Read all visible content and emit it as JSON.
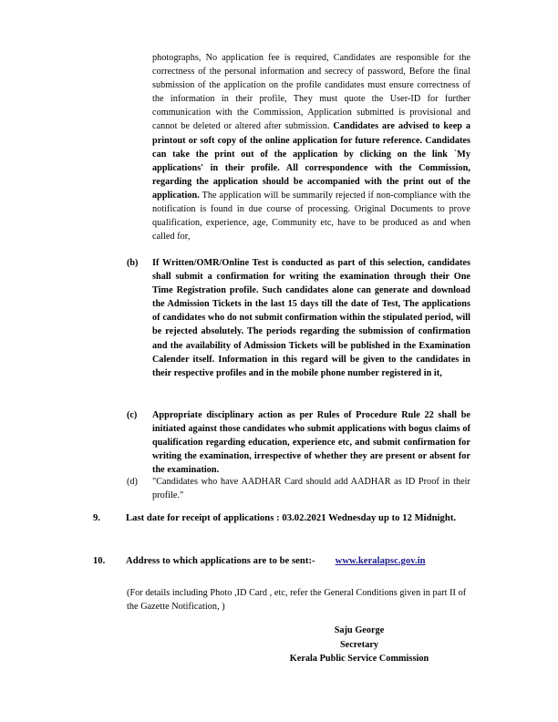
{
  "document": {
    "page_background": "#ffffff",
    "text_color": "#000000",
    "link_color": "#1a1a8c"
  },
  "continued_paragraph": {
    "segment_1": "photographs, No application fee is required, Candidates are responsible for the correctness of the personal information and secrecy of password, Before the final submission of the application on the profile candidates must ensure correctness of the information in their profile, They must quote the User-ID for further communication with the Commission, Application submitted is provisional and cannot be deleted or altered after submission. ",
    "segment_2_bold": "Candidates are advised to keep a printout or soft copy of the online application for future reference.  Candidates can take the print out of the application by clicking on the link `My applications' in their profile.    All correspondence with the Commission, regarding the application should be accompanied with the print out of the application.",
    "segment_3": " The application will be summarily rejected if non-compliance with the notification is found in due course of processing. Original Documents to prove qualification, experience, age, Community etc, have to be produced as and when called for,"
  },
  "list_items": [
    {
      "marker": "(b)",
      "bold": true,
      "text": "If Written/OMR/Online Test is conducted as part of this selection, candidates shall submit a confirmation for writing the examination through their One Time Registration profile.  Such candidates alone can generate and download the Admission Tickets in the last 15 days till the date of Test,    The applications of candidates who do not submit confirmation within the stipulated period, will be rejected absolutely. The periods regarding the submission of confirmation and the availability of Admission Tickets will be published in the Examination Calender itself.   Information in this regard will be given to the candidates in their respective profiles and in the mobile phone number registered in it,"
    },
    {
      "marker": "(c)",
      "bold": true,
      "text": "Appropriate disciplinary action as per Rules of Procedure Rule 22 shall be initiated against those candidates who submit applications with bogus claims of qualification regarding education, experience etc, and submit confirmation for writing the examination, irrespective of whether they are present or absent for the examination."
    },
    {
      "marker": "(d)",
      "bold": false,
      "text": "\"Candidates who have AADHAR Card should add AADHAR as ID Proof in their profile.\""
    }
  ],
  "numbered_items": [
    {
      "marker": "9.",
      "text": "Last date for receipt of applications : 03.02.2021   Wednesday up to 12 Midnight."
    },
    {
      "marker": "10.",
      "label": "Address to which applications are to be sent:-",
      "link_text": "www.keralapsc.gov.in"
    }
  ],
  "note": "(For details including Photo ,ID Card , etc, refer the General Conditions given in part II of the Gazette Notification, )",
  "signature": {
    "name": "Saju George",
    "designation": "Secretary",
    "organisation": "Kerala Public Service Commission"
  }
}
